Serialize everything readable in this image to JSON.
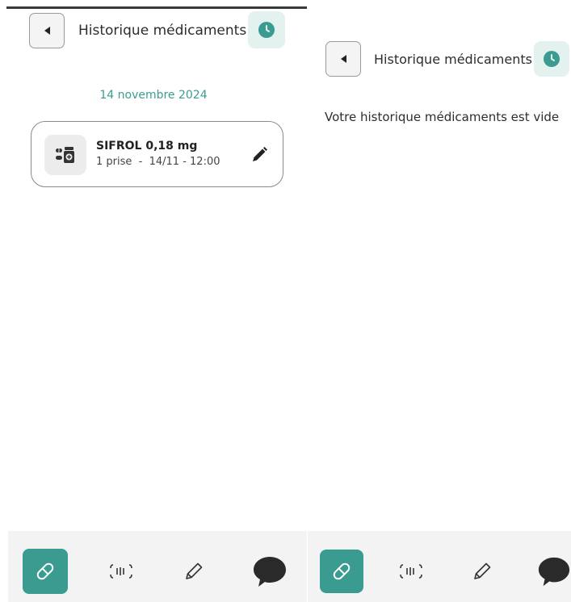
{
  "colors": {
    "accent": "#3a9c90",
    "clock_badge_bg": "#e3f1ef",
    "nav_bg": "#f3f3f3",
    "text": "#2d2d2d"
  },
  "left_screen": {
    "header": {
      "back_icon": "back-arrow-icon",
      "title": "Historique médicaments",
      "badge_icon": "clock-icon"
    },
    "history_groups": [
      {
        "date": "14 novembre 2024",
        "items": [
          {
            "icon": "medication-icon",
            "name": "SIFROL 0,18 mg",
            "detail": "1 prise  -  14/11 - 12:00",
            "action_icon": "pencil-icon"
          }
        ]
      }
    ],
    "bottom_nav": [
      {
        "icon": "pill-icon",
        "active": true
      },
      {
        "icon": "barcode-scan-icon",
        "active": false
      },
      {
        "icon": "pencil-icon",
        "active": false
      },
      {
        "icon": "chat-bubble-icon",
        "active": false
      }
    ]
  },
  "right_screen": {
    "header": {
      "back_icon": "back-arrow-icon",
      "title": "Historique médicaments",
      "badge_icon": "clock-icon"
    },
    "empty_message": "Votre historique médicaments est vide",
    "bottom_nav": [
      {
        "icon": "pill-icon",
        "active": true
      },
      {
        "icon": "barcode-scan-icon",
        "active": false
      },
      {
        "icon": "pencil-icon",
        "active": false
      },
      {
        "icon": "chat-bubble-icon",
        "active": false
      }
    ]
  }
}
